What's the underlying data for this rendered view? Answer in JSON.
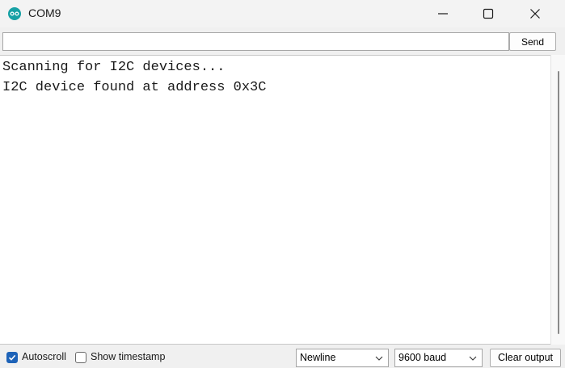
{
  "window": {
    "title": "COM9",
    "icon": "arduino-icon",
    "controls": [
      "minimize-icon",
      "maximize-icon",
      "close-icon"
    ]
  },
  "input": {
    "value": "",
    "send_label": "Send"
  },
  "output": {
    "lines": [
      "Scanning for I2C devices...",
      "I2C device found at address 0x3C"
    ]
  },
  "footer": {
    "autoscroll": {
      "label": "Autoscroll",
      "checked": true
    },
    "timestamp": {
      "label": "Show timestamp",
      "checked": false
    },
    "line_ending": {
      "selected": "Newline"
    },
    "baud": {
      "selected": "9600 baud"
    },
    "clear_label": "Clear output"
  },
  "colors": {
    "accent": "#1e63b8",
    "arduino_teal": "#17a1a5"
  }
}
